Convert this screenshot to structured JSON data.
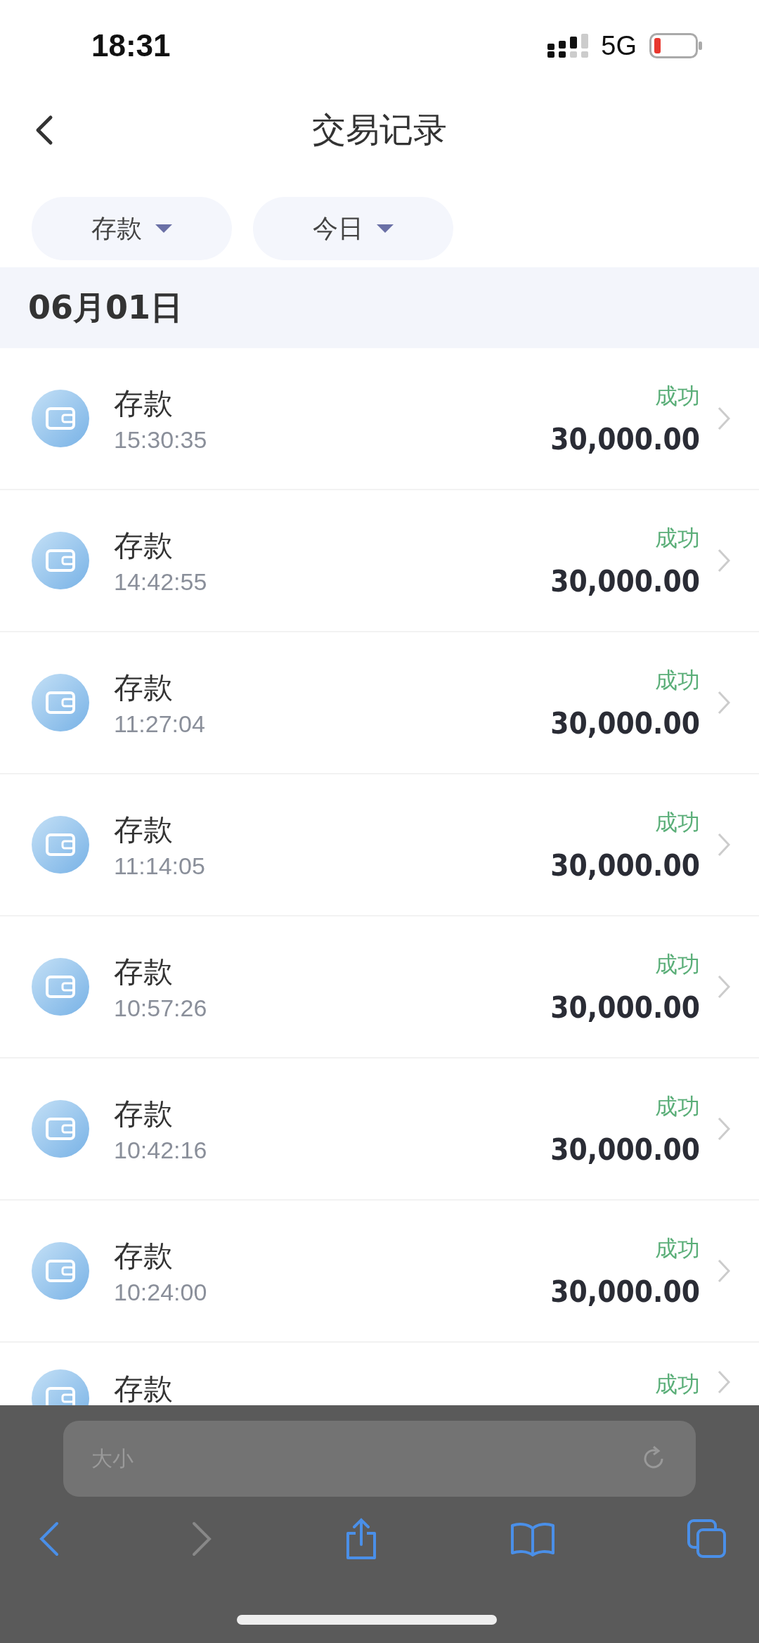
{
  "status_bar": {
    "time": "18:31",
    "network": "5G"
  },
  "header": {
    "title": "交易记录"
  },
  "filters": [
    {
      "label": "存款"
    },
    {
      "label": "今日"
    }
  ],
  "date_header": "06月01日",
  "transactions": [
    {
      "title": "存款",
      "time": "15:30:35",
      "status": "成功",
      "amount": "30,000.00"
    },
    {
      "title": "存款",
      "time": "14:42:55",
      "status": "成功",
      "amount": "30,000.00"
    },
    {
      "title": "存款",
      "time": "11:27:04",
      "status": "成功",
      "amount": "30,000.00"
    },
    {
      "title": "存款",
      "time": "11:14:05",
      "status": "成功",
      "amount": "30,000.00"
    },
    {
      "title": "存款",
      "time": "10:57:26",
      "status": "成功",
      "amount": "30,000.00"
    },
    {
      "title": "存款",
      "time": "10:42:16",
      "status": "成功",
      "amount": "30,000.00"
    },
    {
      "title": "存款",
      "time": "10:24:00",
      "status": "成功",
      "amount": "30,000.00"
    },
    {
      "title": "存款",
      "status": "成功"
    }
  ],
  "browser_toolbar": {
    "address": "大小",
    "back_disabled": false,
    "forward_disabled": true
  }
}
